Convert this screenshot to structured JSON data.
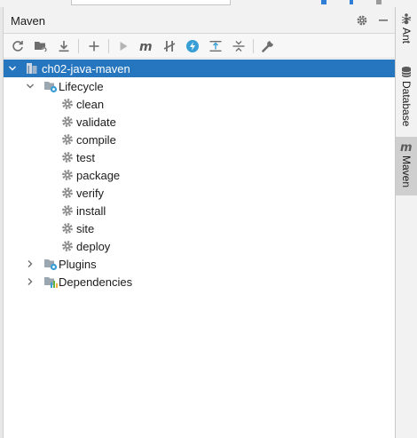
{
  "tool_window": {
    "title": "Maven"
  },
  "toolbar": {
    "buttons": [
      {
        "name": "reload-icon"
      },
      {
        "name": "add-maven-projects-icon"
      },
      {
        "name": "download-sources-icon"
      },
      {
        "name": "add-icon"
      },
      {
        "name": "run-icon"
      },
      {
        "name": "execute-goal-icon"
      },
      {
        "name": "toggle-offline-icon"
      },
      {
        "name": "skip-tests-icon"
      },
      {
        "name": "show-dependencies-icon"
      },
      {
        "name": "collapse-all-icon"
      },
      {
        "name": "settings-wrench-icon"
      }
    ]
  },
  "tree": {
    "project": "ch02-java-maven",
    "lifecycle_label": "Lifecycle",
    "lifecycle_goals": [
      "clean",
      "validate",
      "compile",
      "test",
      "package",
      "verify",
      "install",
      "site",
      "deploy"
    ],
    "plugins_label": "Plugins",
    "dependencies_label": "Dependencies"
  },
  "right_stripe": {
    "items": [
      "Ant",
      "Database",
      "Maven"
    ],
    "active": "Maven"
  },
  "colors": {
    "selection": "#2675bf",
    "maven_m": "#c75450",
    "accent_blue": "#389fd6"
  }
}
